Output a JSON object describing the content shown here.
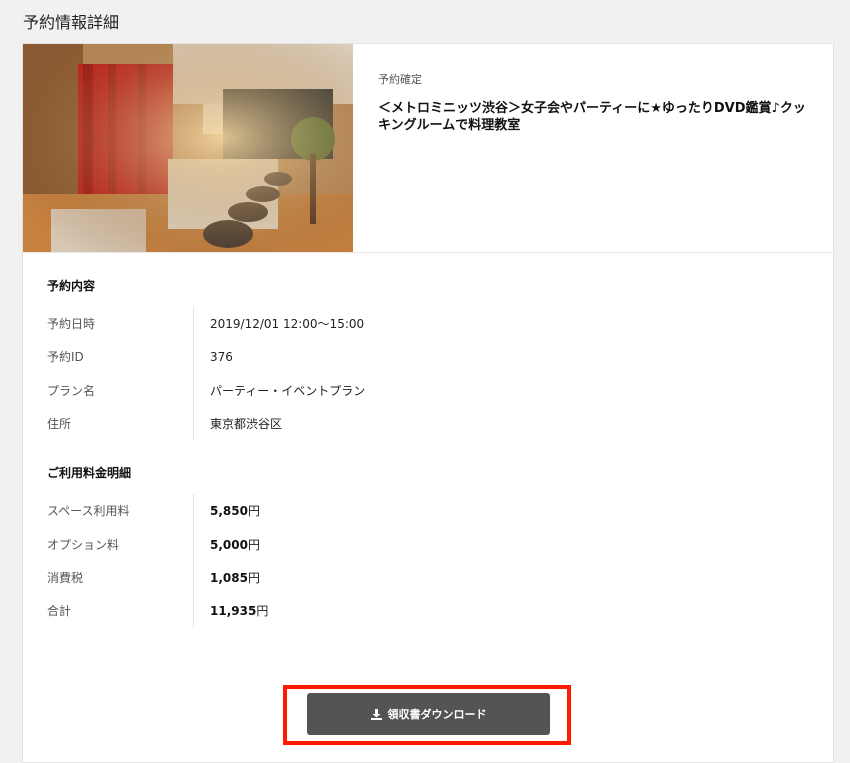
{
  "page": {
    "title": "予約情報詳細"
  },
  "reservation": {
    "status": "予約確定",
    "plan_title": "＜メトロミニッツ渋谷＞女子会やパーティーに★ゆったりDVD鑑賞♪クッキングルームで料理教室"
  },
  "details": {
    "heading": "予約内容",
    "rows": [
      {
        "label": "予約日時",
        "value": "2019/12/01 12:00〜15:00"
      },
      {
        "label": "予約ID",
        "value": "376"
      },
      {
        "label": "プラン名",
        "value": "パーティー・イベントプラン"
      },
      {
        "label": "住所",
        "value": "東京都渋谷区"
      }
    ]
  },
  "fees": {
    "heading": "ご利用料金明細",
    "currency": "円",
    "rows": [
      {
        "label": "スペース利用料",
        "amount": "5,850"
      },
      {
        "label": "オプション料",
        "amount": "5,000"
      },
      {
        "label": "消費税",
        "amount": "1,085"
      },
      {
        "label": "合計",
        "amount": "11,935"
      }
    ]
  },
  "actions": {
    "download_label": "領収書ダウンロード"
  },
  "colors": {
    "highlight_border": "#ff1a00",
    "button_bg": "#545454",
    "page_bg": "#f1f1f1"
  },
  "icons": {
    "download": "download-icon"
  }
}
